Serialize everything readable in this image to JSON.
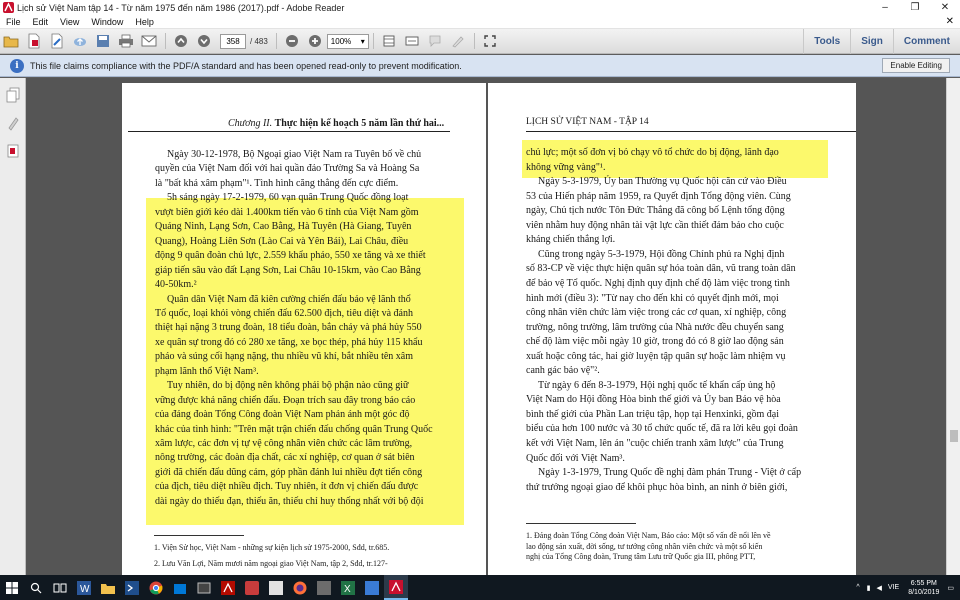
{
  "window": {
    "title": "Lịch sử Việt Nam tập 14 - Từ năm 1975 đến năm 1986 (2017).pdf - Adobe Reader",
    "minimize": "–",
    "restore": "❐",
    "close": "✕"
  },
  "menu": {
    "items": [
      "File",
      "Edit",
      "View",
      "Window",
      "Help"
    ],
    "close_doc": "✕"
  },
  "toolbar": {
    "page_current": "358",
    "page_total": "/ 483",
    "zoom": "100%",
    "tools": "Tools",
    "sign": "Sign",
    "comment": "Comment"
  },
  "infobar": {
    "icon": "i",
    "message": "This file claims compliance with the PDF/A standard and has been opened read-only to prevent modification.",
    "enable_editing": "Enable Editing"
  },
  "left_page": {
    "running_head_italic": "Chương II.",
    "running_head_bold": "Thực hiện kế hoạch 5 năm lần thứ hai...",
    "lines": [
      "Ngày 30-12-1978, Bộ Ngoại giao Việt Nam ra Tuyên bố về chủ",
      "quyền của Việt Nam đối với hai quần đảo Trường Sa và Hoàng Sa",
      "là \"bất khả xâm phạm\"¹. Tình hình căng thẳng đến cực điểm.",
      "5h sáng ngày 17-2-1979, 60 vạn quân Trung Quốc đồng loạt",
      "vượt biên giới kéo dài 1.400km tiến vào 6 tỉnh của Việt Nam gồm",
      "Quảng Ninh, Lạng Sơn, Cao Bằng, Hà Tuyên (Hà Giang, Tuyên",
      "Quang), Hoàng Liên Sơn (Lào Cai và Yên Bái), Lai Châu, điều",
      "động 9 quân đoàn chủ lực, 2.559 khẩu pháo, 550 xe tăng và xe thiết",
      "giáp tiến sâu vào đất Lạng Sơn, Lai Châu 10-15km, vào Cao Bằng",
      "40-50km.²",
      "Quân dân Việt Nam đã kiên cường chiến đấu bảo vệ lãnh thổ",
      "Tổ quốc, loại khỏi vòng chiến đấu 62.500 địch, tiêu diệt và đánh",
      "thiệt hại nặng 3 trung đoàn, 18 tiểu đoàn, bắn cháy và phá hủy 550",
      "xe quân sự trong đó có 280 xe tăng, xe bọc thép, phá hủy 115 khẩu",
      "pháo và súng cối hạng nặng, thu nhiều vũ khí, bắt nhiều tên xâm",
      "phạm lãnh thổ Việt Nam³.",
      "Tuy nhiên, do bị động nên không phải bộ phận nào cũng giữ",
      "vững được khả năng chiến đấu. Đoạn trích sau đây trong báo cáo",
      "của đảng đoàn Tổng Công đoàn Việt Nam phản ánh một góc độ",
      "khác của tình hình: \"Trên mặt trận chiến đấu chống quân Trung Quốc",
      "xâm lược, các đơn vị tự vệ công nhân viên chức các lâm trường,",
      "nông trường, các đoàn địa chất, các xí nghiệp, cơ quan ở sát biên",
      "giới đã chiến đấu dũng cảm, góp phần đánh lui nhiều đợt tiến công",
      "của địch, tiêu diệt nhiều địch. Tuy nhiên, ít đơn vị chiến đấu được",
      "dài ngày do thiếu đạn, thiếu ăn, thiếu chỉ huy thống nhất với bộ đội"
    ],
    "footnotes": [
      "1. Viện Sử học, Việt Nam - những sự kiện lịch sử 1975-2000, Sđd, tr.685.",
      "2. Lưu Văn Lợi, Năm mươi năm ngoại giao Việt Nam, tập 2, Sđd, tr.127-"
    ]
  },
  "right_page": {
    "running_head": "LỊCH SỬ VIỆT NAM - TẬP 14",
    "lines": [
      "chủ lực; một số đơn vị bỏ chạy vô tổ chức do bị động, lãnh đạo",
      "không vững vàng\"¹.",
      "Ngày 5-3-1979, Ủy ban Thường vụ Quốc hội căn cứ vào Điều",
      "53 của Hiến pháp năm 1959, ra Quyết định Tổng động viên. Cùng",
      "ngày, Chủ tịch nước Tôn Đức Thắng đã công bố Lệnh tổng động",
      "viên nhằm huy động nhân tài vật lực cần thiết đảm bảo cho cuộc",
      "kháng chiến thắng lợi.",
      "Cũng trong ngày 5-3-1979, Hội đồng Chính phủ ra Nghị định",
      "số 83-CP về việc thực hiện quân sự hóa toàn dân, vũ trang toàn dân",
      "để bảo vệ Tổ quốc. Nghị định quy định chế độ làm việc trong tình",
      "hình mới (điều 3): \"Từ nay cho đến khi có quyết định mới, mọi",
      "công nhân viên chức làm việc trong các cơ quan, xí nghiệp, công",
      "trường, nông trường, lâm trường của Nhà nước đều chuyển sang",
      "chế độ làm việc mỗi ngày 10 giờ, trong đó có 8 giờ lao động sản",
      "xuất hoặc công tác, hai giờ luyện tập quân sự hoặc làm nhiệm vụ",
      "canh gác bảo vệ\"².",
      "Từ ngày 6 đến 8-3-1979, Hội nghị quốc tế khẩn cấp ủng hộ",
      "Việt Nam do Hội đồng Hòa bình thế giới và Ủy ban Bảo vệ hòa",
      "bình thế giới của Phần Lan triệu tập, họp tại Henxinki, gồm đại",
      "biểu của hơn 100 nước và 30 tổ chức quốc tế, đã ra lời kêu gọi đoàn",
      "kết với Việt Nam, lên án \"cuộc chiến tranh xâm lược\" của Trung",
      "Quốc đối với Việt Nam³.",
      "Ngày 1-3-1979, Trung Quốc đề nghị đàm phán Trung - Việt ở cấp",
      "thứ trưởng ngoại giao để khôi phục hòa bình, an ninh ở biên giới,"
    ],
    "footnotes": [
      "1. Đảng đoàn Tổng Công đoàn Việt Nam, Báo cáo: Một số vấn đề nổi lên về",
      "lao động sản xuất, đời sống, tư tưởng công nhân viên chức và một số kiến",
      "nghị của Tổng Công đoàn, Trung tâm Lưu trữ Quốc gia III, phông PTT,"
    ]
  },
  "taskbar": {
    "lang": "VIE",
    "time": "6:55 PM",
    "date": "8/10/2019"
  },
  "colors": {
    "highlight": "#fcf96c",
    "taskbar": "#101820",
    "accent": "#3a5a8c"
  }
}
